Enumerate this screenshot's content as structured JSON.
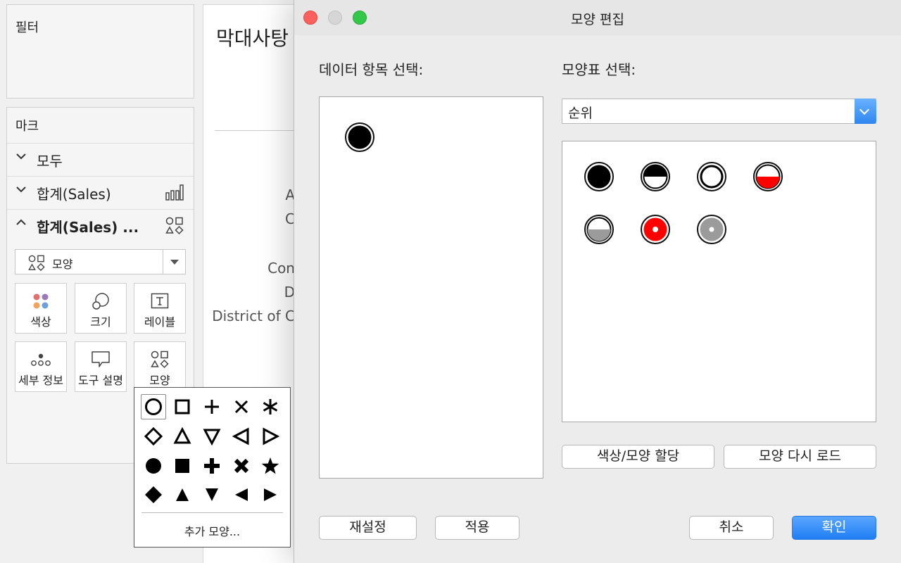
{
  "filters": {
    "title": "필터"
  },
  "marks": {
    "title": "마크",
    "rows": [
      {
        "label": "모두",
        "chevron": "chevron-down-icon"
      },
      {
        "label": "합계(Sales)",
        "chevron": "chevron-down-icon",
        "icon": "bar-chart-icon"
      },
      {
        "label": "합계(Sales) ...",
        "chevron": "chevron-up-icon",
        "icon": "shapes-icon"
      }
    ],
    "mark_type": {
      "label": "모양",
      "icon": "shapes-icon"
    },
    "cards": [
      "색상",
      "크기",
      "레이블",
      "세부 정보",
      "도구 설명",
      "모양"
    ]
  },
  "sheet": {
    "title": "막대사탕",
    "row_labels": [
      "A",
      "C",
      "Con",
      "D",
      "District of C"
    ]
  },
  "shape_popup": {
    "shapes": [
      "circle-outline",
      "square-outline",
      "plus",
      "cross",
      "asterisk",
      "diamond-outline",
      "triangle-up-outline",
      "triangle-down-outline",
      "triangle-left-outline",
      "triangle-right-outline",
      "circle-filled",
      "square-filled",
      "plus-filled",
      "cross-filled",
      "star-filled",
      "diamond-filled",
      "triangle-up-filled",
      "triangle-down-filled",
      "triangle-left-filled",
      "triangle-right-filled"
    ],
    "selected": "circle-outline",
    "more_label": "추가 모양..."
  },
  "dialog": {
    "title": "모양 편집",
    "data_item_label": "데이터 항목 선택:",
    "palette_label": "모양표 선택:",
    "palette_selected": "순위",
    "assign_button": "색상/모양 할당",
    "reload_button": "모양 다시 로드",
    "reset_button": "재설정",
    "apply_button": "적용",
    "cancel_button": "취소",
    "ok_button": "확인",
    "palette_shapes": [
      "rank-black-filled",
      "rank-half-black",
      "rank-ring",
      "rank-half-red",
      "rank-half-gray",
      "rank-red-dot",
      "rank-gray-dot"
    ],
    "colors": {
      "red": "#ff0000",
      "gray": "#9b9b9b",
      "accent": "#2f86f0"
    }
  }
}
